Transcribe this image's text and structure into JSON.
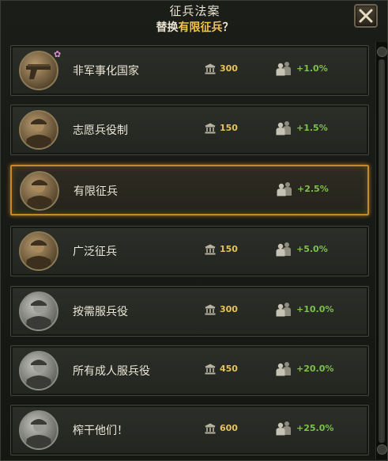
{
  "header": {
    "title": "征兵法案",
    "subtitle_prefix": "替换",
    "subtitle_highlight": "有限征兵",
    "subtitle_suffix": "？"
  },
  "close_icon": "close-x-icon",
  "laws": [
    {
      "name": "非军事化国家",
      "cost": "300",
      "manpower": "+1.0%",
      "portrait": "pistol-icon",
      "selected": false
    },
    {
      "name": "志愿兵役制",
      "cost": "150",
      "manpower": "+1.5%",
      "portrait": "volunteer-soldier-icon",
      "selected": false
    },
    {
      "name": "有限征兵",
      "cost": "",
      "manpower": "+2.5%",
      "portrait": "limited-conscription-soldiers-icon",
      "selected": true
    },
    {
      "name": "广泛征兵",
      "cost": "150",
      "manpower": "+5.0%",
      "portrait": "extensive-conscription-soldiers-icon",
      "selected": false
    },
    {
      "name": "按需服兵役",
      "cost": "300",
      "manpower": "+10.0%",
      "portrait": "service-by-requirement-icon",
      "selected": false
    },
    {
      "name": "所有成人服兵役",
      "cost": "450",
      "manpower": "+20.0%",
      "portrait": "all-adults-serve-icon",
      "selected": false
    },
    {
      "name": "榨干他们！",
      "cost": "600",
      "manpower": "+25.0%",
      "portrait": "scraping-the-barrel-icon",
      "selected": false
    }
  ],
  "colors": {
    "highlight": "#f2c448",
    "cost": "#e8c35a",
    "manpower_positive": "#7dc04a",
    "selected_border": "#c58a2a"
  }
}
